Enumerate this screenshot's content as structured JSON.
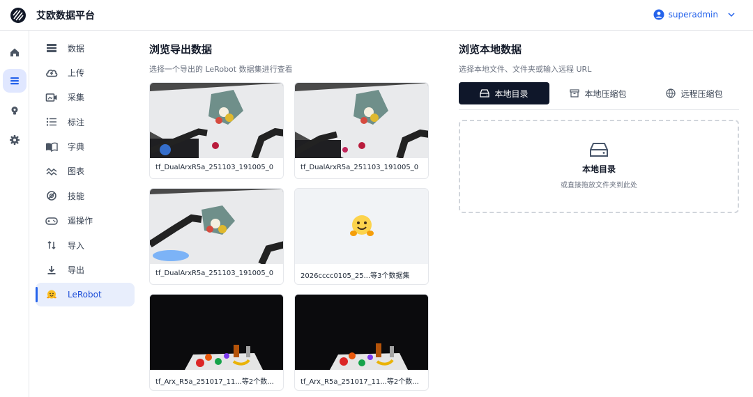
{
  "app": {
    "title": "艾欧数据平台"
  },
  "user": {
    "name": "superadmin"
  },
  "rail": [
    "home-icon",
    "list-icon",
    "bulb-icon",
    "gear-icon"
  ],
  "nav": {
    "items": [
      {
        "label": "数据",
        "icon": "table-icon"
      },
      {
        "label": "上传",
        "icon": "cloud-upload-icon"
      },
      {
        "label": "采集",
        "icon": "video-capture-icon"
      },
      {
        "label": "标注",
        "icon": "annotation-list-icon"
      },
      {
        "label": "字典",
        "icon": "book-icon"
      },
      {
        "label": "图表",
        "icon": "chart-wave-icon"
      },
      {
        "label": "技能",
        "icon": "skill-icon"
      },
      {
        "label": "遥操作",
        "icon": "gamepad-icon"
      },
      {
        "label": "导入",
        "icon": "import-arrows-icon"
      },
      {
        "label": "导出",
        "icon": "download-icon"
      },
      {
        "label": "LeRobot",
        "icon": "hugging-face-icon"
      }
    ],
    "active": "LeRobot"
  },
  "export_section": {
    "title": "浏览导出数据",
    "subtitle": "选择一个导出的 LeRobot 数据集进行查看",
    "datasets": [
      {
        "name": "tf_DualArxR5a_251103_191005_0",
        "thumb": "robot-arms-fruit-bowl"
      },
      {
        "name": "tf_DualArxR5a_251103_191005_0",
        "thumb": "robot-arms-fruit-bowl"
      },
      {
        "name": "tf_DualArxR5a_251103_191005_0",
        "thumb": "robot-arm-bowl-light"
      },
      {
        "name": "2026cccc0105_25...等3个数据集",
        "thumb": "hugging-face-placeholder"
      },
      {
        "name": "tf_Arx_R5a_251017_11...等2个数...",
        "thumb": "dark-table-fruits"
      },
      {
        "name": "tf_Arx_R5a_251017_11...等2个数...",
        "thumb": "dark-table-fruits"
      }
    ]
  },
  "local_section": {
    "title": "浏览本地数据",
    "subtitle": "选择本地文件、文件夹或输入远程 URL",
    "tabs": [
      {
        "label": "本地目录",
        "icon": "drive-icon"
      },
      {
        "label": "本地压缩包",
        "icon": "archive-icon"
      },
      {
        "label": "远程压缩包",
        "icon": "remote-archive-icon"
      }
    ],
    "active_tab": "本地目录",
    "dropzone": {
      "title": "本地目录",
      "hint": "或直接拖放文件夹到此处",
      "icon": "drive-icon"
    }
  },
  "colors": {
    "accent": "#2563eb",
    "dark_tab": "#0f172a",
    "active_nav_bg": "#e8eefc"
  }
}
